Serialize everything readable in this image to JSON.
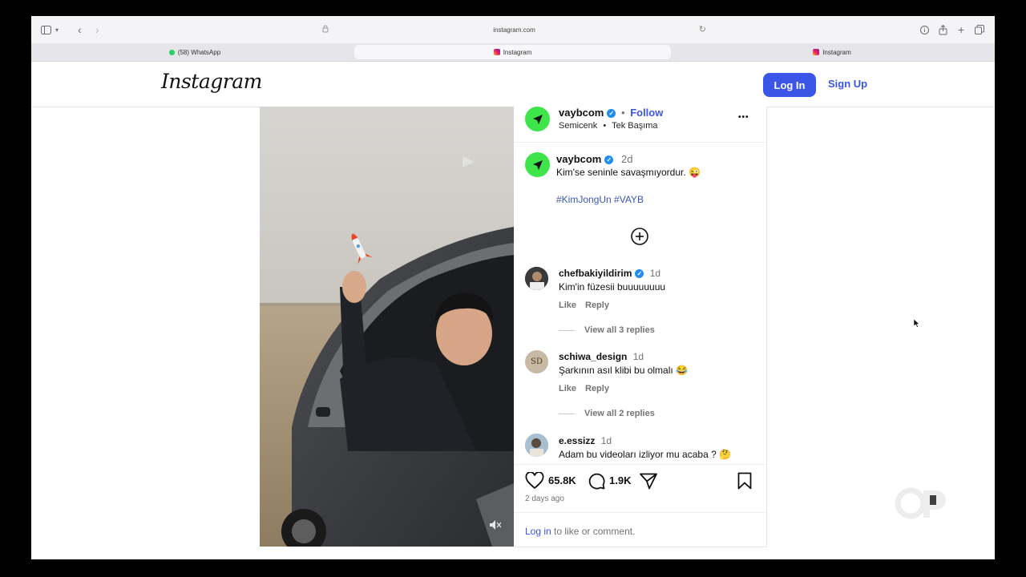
{
  "browser": {
    "url": "instagram.com",
    "tabs": [
      {
        "label": "(58) WhatsApp",
        "icon": "whatsapp-icon"
      },
      {
        "label": "Instagram",
        "icon": "instagram-icon",
        "active": true
      },
      {
        "label": "Instagram",
        "icon": "instagram-icon"
      }
    ]
  },
  "header": {
    "logo": "Instagram",
    "login": "Log In",
    "signup": "Sign Up"
  },
  "post": {
    "author": "vaybcom",
    "follow": "Follow",
    "dot": "•",
    "audio_artist": "Semicenk",
    "audio_title": "Tek Başıma",
    "more": "•••",
    "caption_author": "vaybcom",
    "caption_time": "2d",
    "caption_text": "Kim'se seninle savaşmıyordur. 😜",
    "hashtags": "#KimJongUn #VAYB",
    "likes": "65.8K",
    "comments_count": "1.9K",
    "posted": "2 days ago",
    "login_link": "Log in",
    "login_prompt": " to like or comment."
  },
  "comments": [
    {
      "user": "chefbakiyildirim",
      "verified": true,
      "time": "1d",
      "text": "Kim'in füzesii buuuuuuuu",
      "like": "Like",
      "reply": "Reply",
      "view_replies": "View all 3 replies"
    },
    {
      "user": "schiwa_design",
      "verified": false,
      "time": "1d",
      "text": "Şarkının asıl klibi bu olmalı 😂",
      "like": "Like",
      "reply": "Reply",
      "view_replies": "View all 2 replies",
      "avatar_text": "SD"
    },
    {
      "user": "e.essizz",
      "verified": false,
      "time": "1d",
      "text": "Adam bu videoları izliyor mu acaba ? 🤔"
    }
  ],
  "colors": {
    "accent": "#3b56e6",
    "avatar_green": "#3ee54a",
    "verified": "#1f8cf0"
  }
}
